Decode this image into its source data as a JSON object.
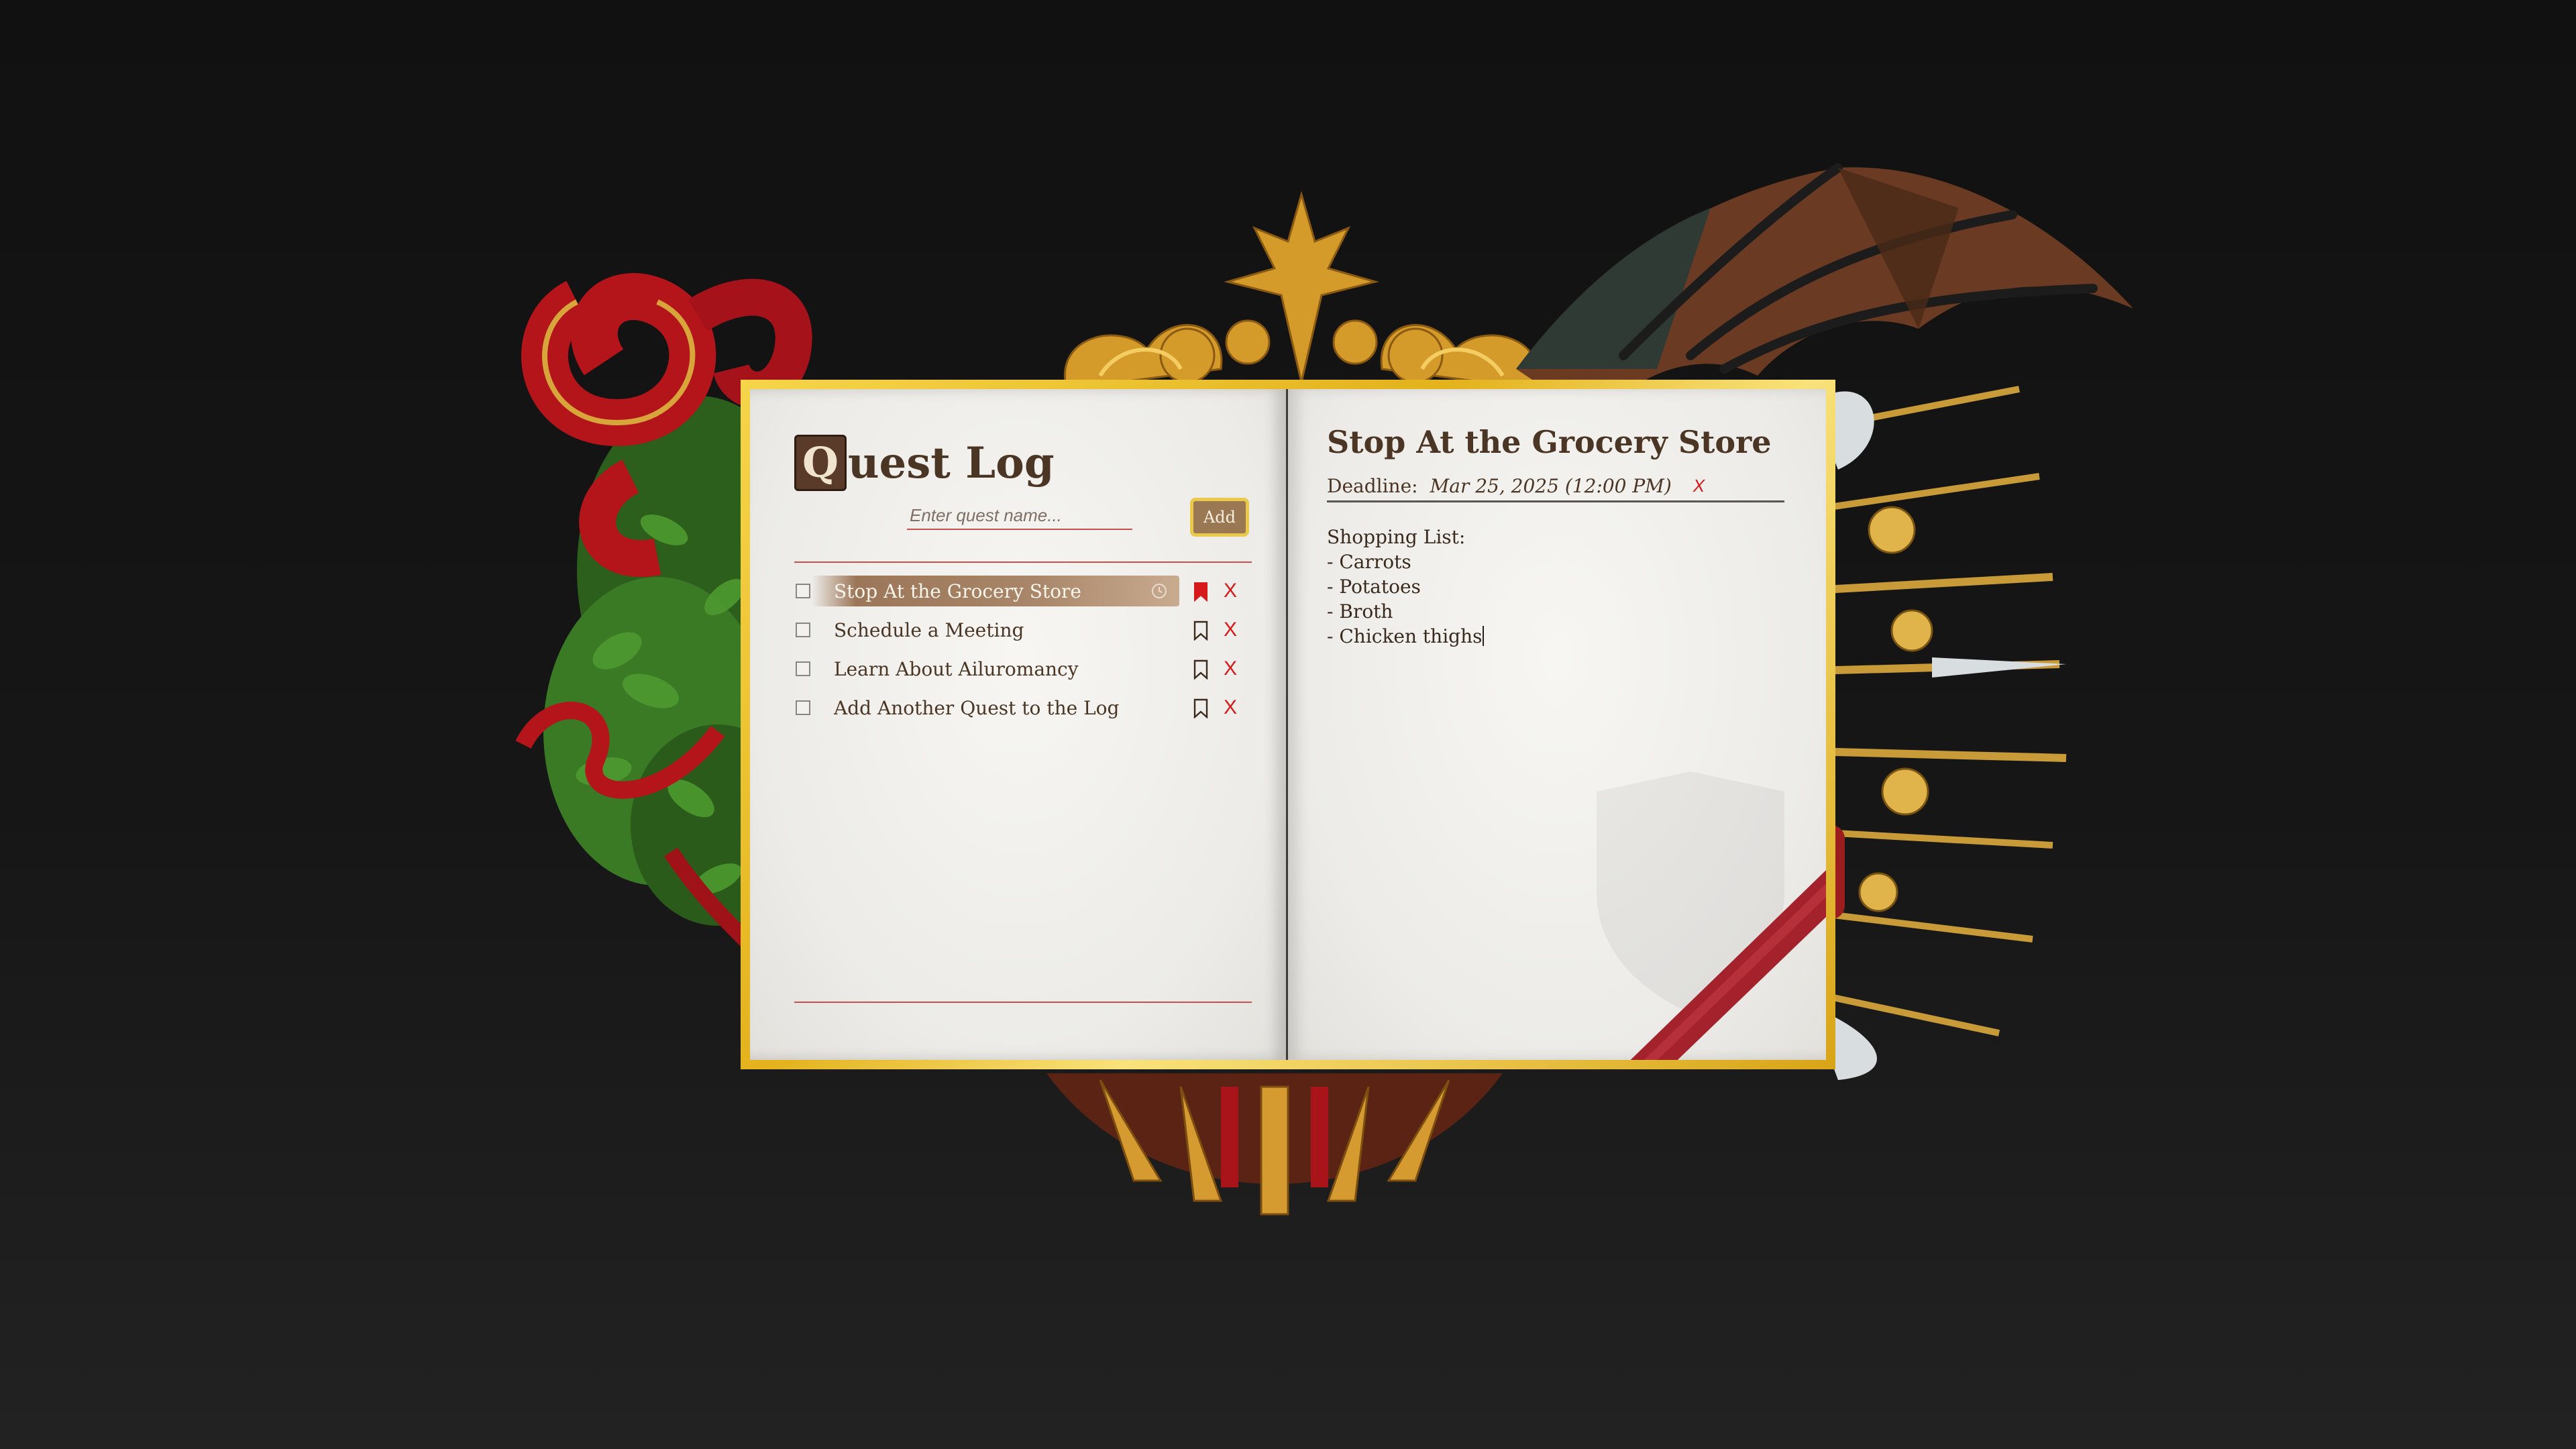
{
  "quest_log": {
    "title_dropcap": "Q",
    "title_rest": "uest Log",
    "input_placeholder": "Enter quest name...",
    "input_value": "",
    "add_label": "Add",
    "quests": [
      {
        "name": "Stop At the Grocery Store",
        "checked": false,
        "selected": true,
        "bookmarked": true,
        "has_deadline": true,
        "delete_label": "X"
      },
      {
        "name": "Schedule a Meeting",
        "checked": false,
        "selected": false,
        "bookmarked": false,
        "has_deadline": false,
        "delete_label": "X"
      },
      {
        "name": "Learn About Ailuromancy",
        "checked": false,
        "selected": false,
        "bookmarked": false,
        "has_deadline": false,
        "delete_label": "X"
      },
      {
        "name": "Add Another Quest to the Log",
        "checked": false,
        "selected": false,
        "bookmarked": false,
        "has_deadline": false,
        "delete_label": "X"
      }
    ]
  },
  "detail": {
    "title": "Stop At the Grocery Store",
    "deadline_label": "Deadline:",
    "deadline_value": "Mar 25, 2025 (12:00 PM)",
    "deadline_clear": "X",
    "notes_lines": [
      "Shopping List:",
      "- Carrots",
      "- Potatoes",
      "- Broth",
      "- Chicken thighs"
    ]
  },
  "colors": {
    "accent_red": "#d7191c",
    "ink_brown": "#4b3524",
    "gold_frame": "#e8bd2a",
    "selected_row": "#a98669"
  },
  "icons": [
    "clock-icon",
    "bookmark-icon",
    "bookmark-filled-icon",
    "close-icon"
  ]
}
